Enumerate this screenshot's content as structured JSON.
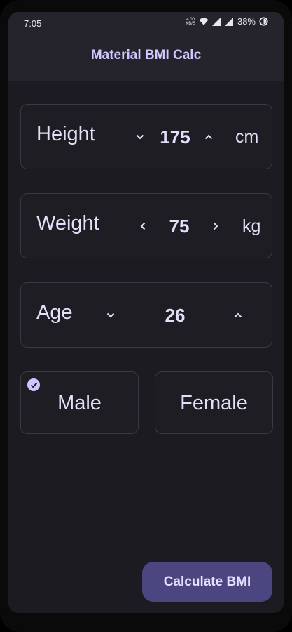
{
  "status_bar": {
    "time": "7:05",
    "net_speed_top": "4.00",
    "net_speed_bottom": "KB/S",
    "battery": "38%"
  },
  "app_bar": {
    "title": "Material BMI Calc"
  },
  "height": {
    "label": "Height",
    "value": "175",
    "unit": "cm"
  },
  "weight": {
    "label": "Weight",
    "value": "75",
    "unit": "kg"
  },
  "age": {
    "label": "Age",
    "value": "26"
  },
  "gender": {
    "male": "Male",
    "female": "Female",
    "selected": "male"
  },
  "action": {
    "label": "Calculate BMI"
  },
  "colors": {
    "accent": "#d2c8ff",
    "background": "#1c1b21",
    "fab": "#4b4580",
    "surface": "#25242c"
  }
}
